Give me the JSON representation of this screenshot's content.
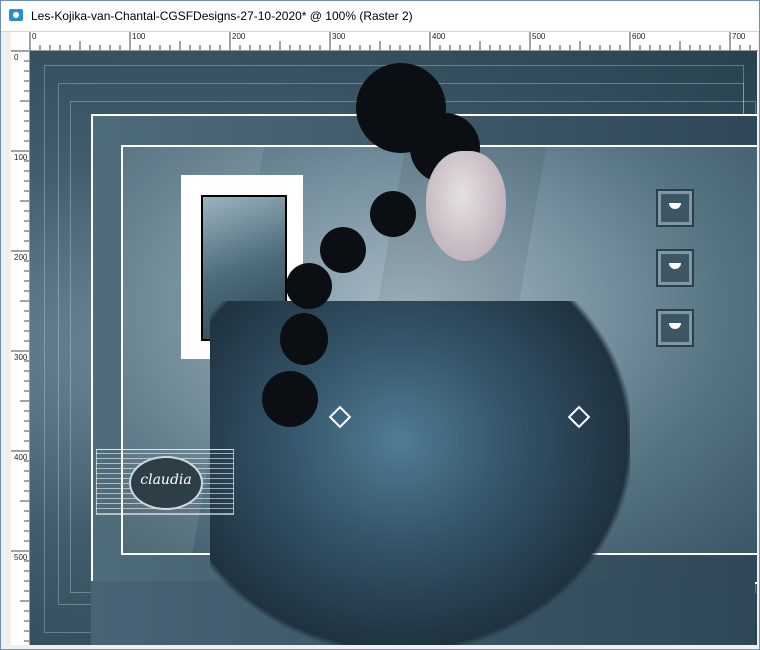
{
  "window": {
    "title": "Les-Kojika-van-Chantal-CGSFDesigns-27-10-2020* @ 100% (Raster 2)",
    "icon": "paint-shop-pro-icon"
  },
  "rulers": {
    "horizontal_labels": [
      "0",
      "100",
      "200",
      "300",
      "400",
      "500",
      "600",
      "700"
    ],
    "vertical_labels": [
      "0",
      "100",
      "200",
      "300",
      "400",
      "500"
    ]
  },
  "canvas": {
    "watermark_text": "claudia",
    "colors": {
      "background": "#3e5664",
      "frame_white": "#ffffff",
      "accent_blue": "#345468"
    }
  }
}
